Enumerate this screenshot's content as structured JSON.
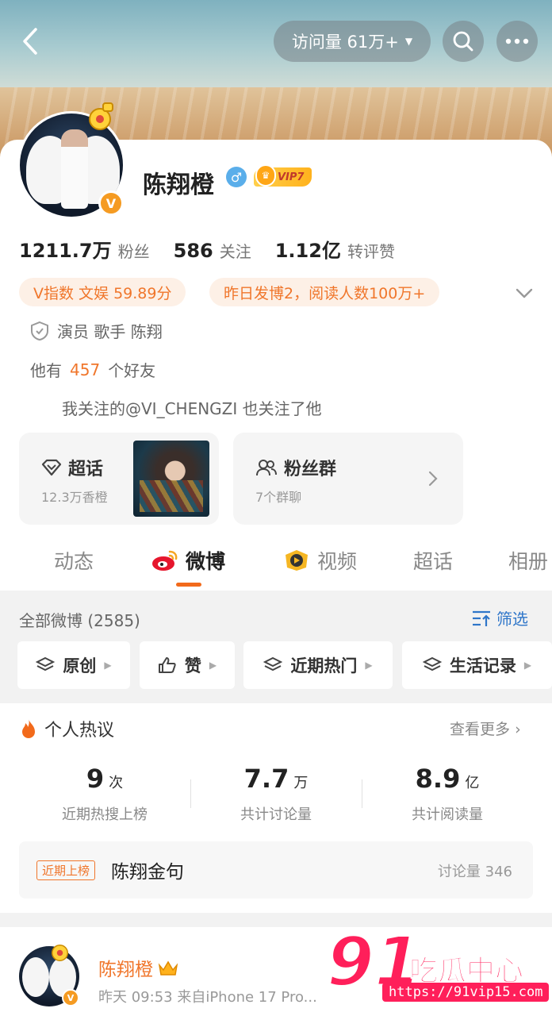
{
  "header": {
    "visit_label": "访问量 61万+",
    "colors": {
      "accent": "#f0762b",
      "link": "#2f76c9"
    }
  },
  "profile": {
    "name": "陈翔橙",
    "vip_label": "VIP7",
    "gender_symbol": "♂",
    "verified_mark": "V",
    "stats": [
      {
        "num": "1211.7万",
        "label": "粉丝"
      },
      {
        "num": "586",
        "label": "关注"
      },
      {
        "num": "1.12亿",
        "label": "转评赞"
      }
    ],
    "pill_vindex": "V指数 文娱 59.89分",
    "pill_posts": "昨日发博2，阅读人数100万+",
    "tags": "演员 歌手 陈翔",
    "friends_prefix": "他有",
    "friends_count": "457",
    "friends_suffix": "个好友",
    "mutual_follow": "我关注的@VI_CHENGZI 也关注了他"
  },
  "features": {
    "chaohua": {
      "title": "超话",
      "sub": "12.3万香橙"
    },
    "fans_group": {
      "title": "粉丝群",
      "sub": "7个群聊"
    }
  },
  "tabs": [
    {
      "label": "动态"
    },
    {
      "label": "微博"
    },
    {
      "label": "视频"
    },
    {
      "label": "超话"
    },
    {
      "label": "相册"
    }
  ],
  "weibo_section": {
    "all_label": "全部微博 (2585)",
    "filter_label": "筛选",
    "chips": [
      "原创",
      "赞",
      "近期热门",
      "生活记录"
    ]
  },
  "hot": {
    "title": "个人热议",
    "see_more": "查看更多",
    "stats": [
      {
        "value": "9",
        "unit": "次",
        "label": "近期热搜上榜"
      },
      {
        "value": "7.7",
        "unit": "万",
        "label": "共计讨论量"
      },
      {
        "value": "8.9",
        "unit": "亿",
        "label": "共计阅读量"
      }
    ],
    "rank_tag": "近期上榜",
    "rank_title": "陈翔金句",
    "rank_count": "讨论量 346"
  },
  "post": {
    "name": "陈翔橙",
    "meta": "昨天 09:53  来自iPhone 17 Pro..."
  },
  "watermark": {
    "brand_num": "91",
    "brand_text": "吃瓜中心",
    "url": "https://91vip15.com"
  }
}
